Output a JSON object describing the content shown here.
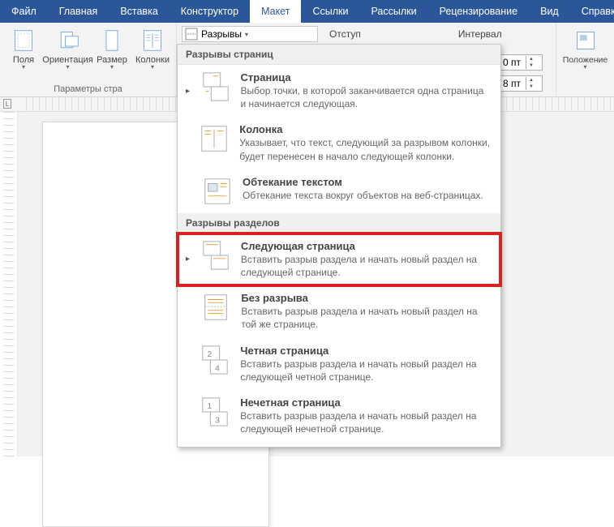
{
  "tabs": {
    "file": "Файл",
    "items": [
      "Главная",
      "Вставка",
      "Конструктор",
      "Макет",
      "Ссылки",
      "Рассылки",
      "Рецензирование",
      "Вид",
      "Справка"
    ],
    "active_index": 3
  },
  "ribbon": {
    "page_setup": {
      "fields": "Поля",
      "orientation": "Ориентация",
      "size": "Размер",
      "columns": "Колонки",
      "group_label": "Параметры стра"
    },
    "breaks_button": "Разрывы",
    "paragraph": {
      "indent_label": "Отступ",
      "spacing_label": "Интервал",
      "before_value": "0 пт",
      "after_value": "8 пт"
    },
    "arrange": {
      "position": "Положение"
    }
  },
  "dropdown": {
    "section1_header": "Разрывы страниц",
    "section2_header": "Разрывы разделов",
    "items": [
      {
        "title": "Страница",
        "desc": "Выбор точки, в которой заканчивается одна страница и начинается следующая."
      },
      {
        "title": "Колонка",
        "desc": "Указывает, что текст, следующий за разрывом колонки, будет перенесен в начало следующей колонки."
      },
      {
        "title": "Обтекание текстом",
        "desc": "Обтекание текста вокруг объектов на веб-страницах."
      },
      {
        "title": "Следующая страница",
        "desc": "Вставить разрыв раздела и начать новый раздел на следующей странице."
      },
      {
        "title": "Без разрыва",
        "desc": "Вставить разрыв раздела и начать новый раздел на той же странице."
      },
      {
        "title": "Четная страница",
        "desc": "Вставить разрыв раздела и начать новый раздел на следующей четной странице."
      },
      {
        "title": "Нечетная страница",
        "desc": "Вставить разрыв раздела и начать новый раздел на следующей нечетной странице."
      }
    ],
    "highlight_index": 3
  },
  "ruler": {
    "corner": "L"
  }
}
